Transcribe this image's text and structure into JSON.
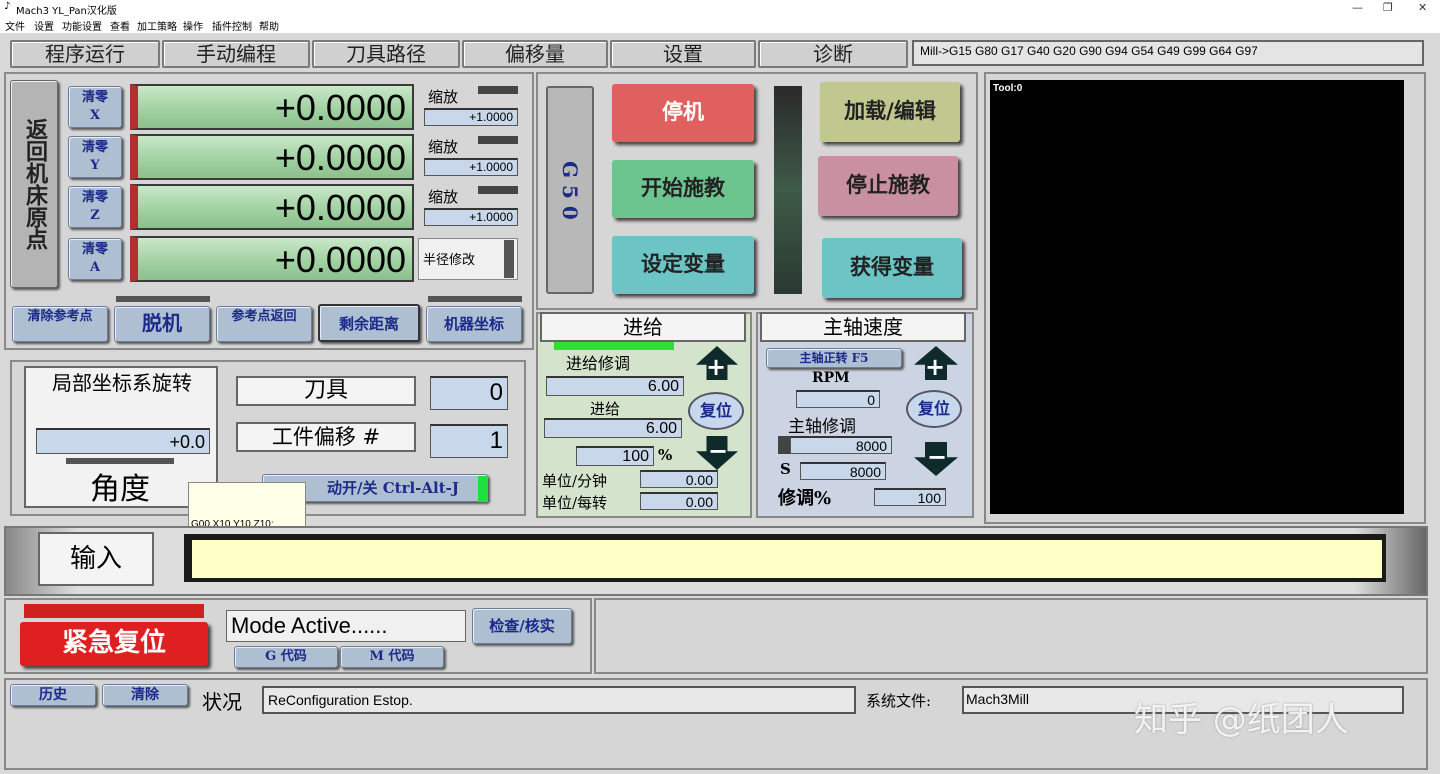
{
  "window": {
    "title": "Mach3 YL_Pan汉化版",
    "minimize": "—",
    "maximize": "❐",
    "close": "✕"
  },
  "menu": [
    "文件",
    "设置",
    "功能设置",
    "查看",
    "加工策略",
    "操作",
    "插件控制",
    "帮助"
  ],
  "tabs": [
    "程序运行",
    "手动编程",
    "刀具路径",
    "偏移量",
    "设置",
    "诊断"
  ],
  "gcode_status": "Mill->G15  G80 G17 G40 G20 G90 G94 G54 G49 G99 G64 G97",
  "home_button": "返回机床原点",
  "axes": [
    {
      "zero_label": "清零",
      "axis": "X",
      "value": "+0.0000",
      "scale_label": "缩放",
      "scale": "+1.0000"
    },
    {
      "zero_label": "清零",
      "axis": "Y",
      "value": "+0.0000",
      "scale_label": "缩放",
      "scale": "+1.0000"
    },
    {
      "zero_label": "清零",
      "axis": "Z",
      "value": "+0.0000",
      "scale_label": "缩放",
      "scale": "+1.0000"
    },
    {
      "zero_label": "清零",
      "axis": "A",
      "value": "+0.0000",
      "scale_label": "半径修改",
      "scale": ""
    }
  ],
  "dro_buttons": {
    "clear_ref": "清除参考点",
    "offline": "脱机",
    "ref_return": "参考点返回",
    "remaining": "剩余距离",
    "machine_coords": "机器坐标"
  },
  "g50": "G 5 0",
  "control": {
    "stop": "停机",
    "load_edit": "加载/编辑",
    "start_teach": "开始施教",
    "stop_teach": "停止施教",
    "set_var": "设定变量",
    "get_var": "获得变量"
  },
  "tool_display": "Tool:0",
  "rotation": {
    "title": "局部坐标系旋转",
    "value": "+0.0",
    "angle": "角度"
  },
  "tool": {
    "label": "刀具",
    "value": "0",
    "offset_label": "工件偏移 #",
    "offset_value": "1",
    "jog_label": "动开/关 Ctrl-Alt-J"
  },
  "tooltip": "G00 X10 Y10 Z10;",
  "feed": {
    "title": "进给",
    "override": "进给修调",
    "override_value": "6.00",
    "feed_label": "进给",
    "feed_value": "6.00",
    "percent": "100",
    "percent_sign": "%",
    "reset": "复位",
    "per_min": "单位/分钟",
    "per_min_value": "0.00",
    "per_rev": "单位/每转",
    "per_rev_value": "0.00"
  },
  "spindle": {
    "title": "主轴速度",
    "cw": "主轴正转 F5",
    "rpm_label": "RPM",
    "rpm": "0",
    "override": "主轴修调",
    "override_value": "8000",
    "s_label": "S",
    "s_value": "8000",
    "reset": "复位",
    "adjust_label": "修调%",
    "adjust_value": "100"
  },
  "input_label": "输入",
  "emergency": "紧急复位",
  "mode": "Mode Active......",
  "check": "检查/核实",
  "g_code": "G 代码",
  "m_code": "M 代码",
  "history": "历史",
  "clear": "清除",
  "status_label": "状况",
  "status": "ReConfiguration Estop.",
  "sysfile_label": "系统文件:",
  "sysfile": "Mach3Mill",
  "watermark": "知乎 @纸团人"
}
